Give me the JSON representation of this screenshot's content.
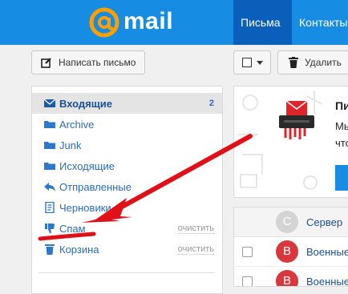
{
  "header": {
    "logo_text": "mail",
    "tabs": [
      {
        "label": "Письма"
      },
      {
        "label": "Контакты"
      }
    ]
  },
  "toolbar": {
    "compose_label": "Написать письмо",
    "delete_label": "Удалить"
  },
  "sidebar": {
    "folders": [
      {
        "label": "Входящие",
        "count": "2"
      },
      {
        "label": "Archive"
      },
      {
        "label": "Junk"
      },
      {
        "label": "Исходящие"
      },
      {
        "label": "Отправленные"
      },
      {
        "label": "Черновики"
      },
      {
        "label": "Спам",
        "action": "очистить"
      },
      {
        "label": "Корзина",
        "action": "очистить"
      }
    ]
  },
  "promo": {
    "title": "Пи",
    "line1": "Мы",
    "line2": "что"
  },
  "mail_list": {
    "header_avatar": "C",
    "header_text": "Сервер",
    "rows": [
      {
        "avatar": "В",
        "sender": "Военные"
      },
      {
        "avatar": "В",
        "sender": "Военные"
      }
    ]
  },
  "colors": {
    "brand": "#168de2",
    "active_tab": "#0a5fba",
    "avatar_red": "#d9363e",
    "annotation_arrow": "#e01019"
  }
}
